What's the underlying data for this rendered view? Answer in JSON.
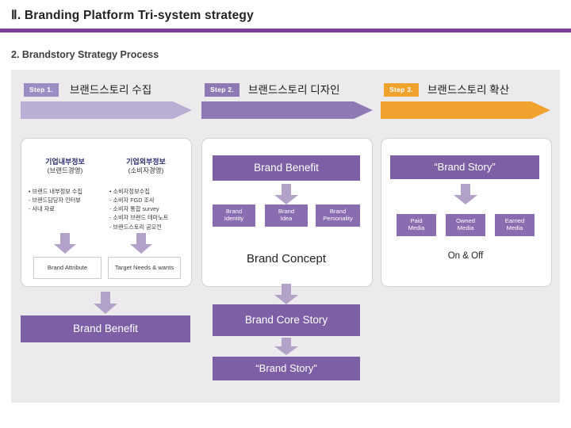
{
  "header": {
    "title": "Ⅱ. Branding Platform Tri-system strategy",
    "section": "2. Brandstory Strategy Process",
    "rule_color": "#7c3f9e"
  },
  "colors": {
    "step1_chip": "#9b8dc4",
    "step2_chip": "#8f79b5",
    "step3_chip": "#f0a22e",
    "chev1": "#b9aed4",
    "chev2": "#8f79b5",
    "chev3": "#f0a22e",
    "purple_box": "#7d5fa6",
    "arrow": "#b3a2c8",
    "panel_bg": "#eceaec"
  },
  "steps": [
    {
      "chip": "Step 1.",
      "label": "브랜드스토리 수집"
    },
    {
      "chip": "Step 2.",
      "label": "브랜드스토리 디자인"
    },
    {
      "chip": "Step 3.",
      "label": "브랜드스토리 확산"
    }
  ],
  "column1": {
    "card_blocks": [
      {
        "title": "기업내부정보",
        "subtitle": "(브랜드경영)",
        "items": "• 브랜드 내부정보 수집\n- 브랜드담당자 인터뷰\n- 사내 자료"
      },
      {
        "title": "기업외부정보",
        "subtitle": "(소비자경영)",
        "items": "• 소비자정보수집\n- 소비자 FGD 조사\n- 소비자 통합 survey\n- 소비자 브랜드 테마노트\n- 브랜드스토리 공모전"
      }
    ],
    "result_boxes": [
      "Brand\nAttribute",
      "Target\nNeeds & wants"
    ],
    "final_box": "Brand Benefit"
  },
  "column2": {
    "top_box": "Brand Benefit",
    "mid_boxes": [
      "Brand\nIdentity",
      "Brand\nIdea",
      "Brand\nPersonality"
    ],
    "concept_box": "Brand Concept",
    "core_story_box": "Brand Core Story",
    "story_box": "“Brand Story”"
  },
  "column3": {
    "top_box": "“Brand Story”",
    "media_boxes": [
      "Paid\nMedia",
      "Owned\nMedia",
      "Earned\nMedia"
    ],
    "footer_text": "On & Off"
  }
}
